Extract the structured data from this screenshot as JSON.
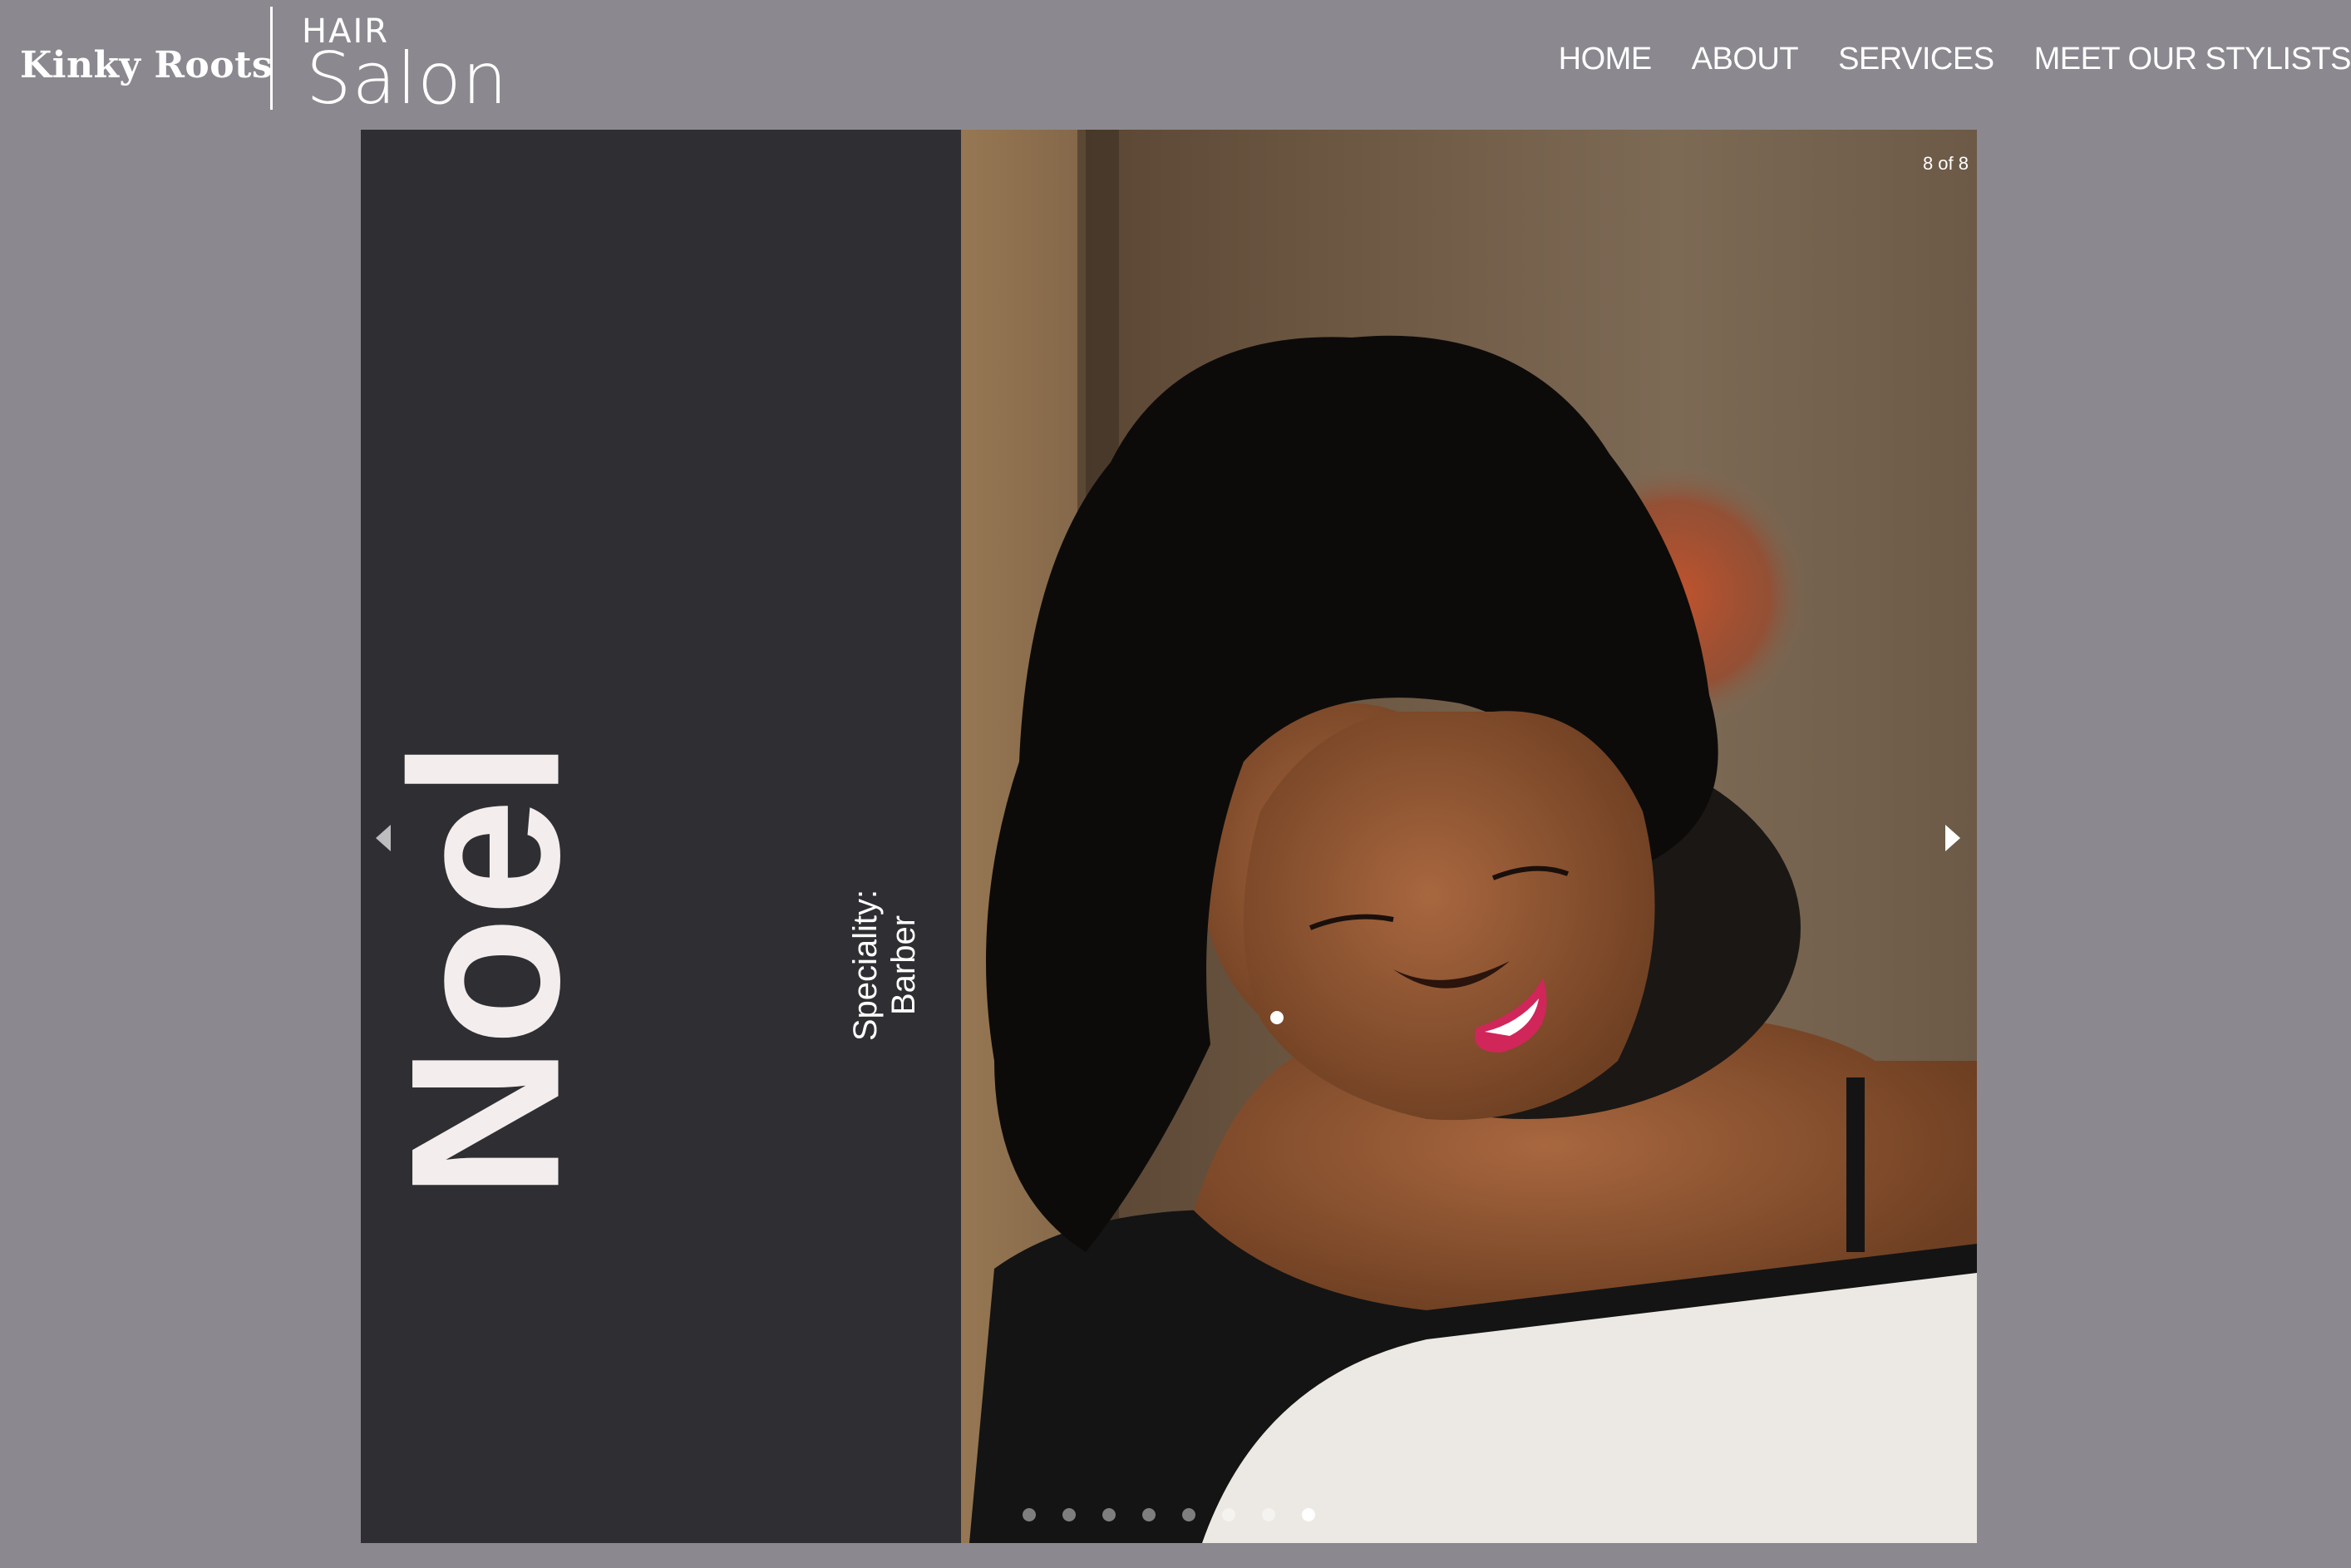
{
  "header": {
    "brand": "Kinky Roots",
    "hair": "HAIR",
    "salon": "Salon",
    "nav": [
      {
        "label": "HOME"
      },
      {
        "label": "ABOUT"
      },
      {
        "label": "SERVICES"
      },
      {
        "label": "MEET OUR STYLISTS"
      }
    ]
  },
  "slider": {
    "stylist_name": "Noel",
    "speciality_label": "Speciality:",
    "speciality_value": "Barber",
    "counter": "8 of 8",
    "slide_count": 8,
    "active_slide": 8,
    "photo_alt": "Smiling woman with curly natural hair",
    "prev_icon": "chevron-left-icon",
    "next_icon": "chevron-right-icon"
  },
  "colors": {
    "page_bg": "#8b898f",
    "panel_bg": "#2f2f33",
    "name_text": "#f3eded"
  }
}
